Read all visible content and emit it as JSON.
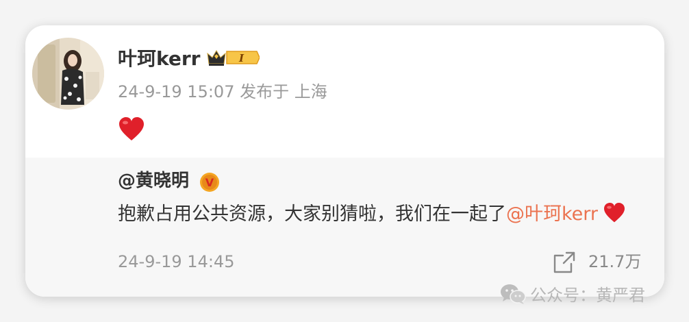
{
  "post": {
    "username": "叶珂kerr",
    "vip_level": "I",
    "timestamp": "24-9-19 15:07",
    "location": "发布于 上海",
    "content_icon": "red-heart-emoji"
  },
  "repost": {
    "author": "@黄晓明",
    "verified_badge": "V",
    "text": "抱歉占用公共资源，大家别猜啦，我们在一起了",
    "mention": "@叶珂kerr",
    "trailing_icon": "red-heart-emoji",
    "timestamp": "24-9-19 14:45",
    "share_count": "21.7万",
    "share_icon": "share-icon"
  },
  "watermark": {
    "icon": "wechat-icon",
    "text": "公众号：黄严君"
  },
  "colors": {
    "mention": "#eb7350",
    "meta_text": "#999999",
    "repost_background": "#f7f7f7",
    "heart": "#e0202a",
    "verified": "#f5a623"
  }
}
